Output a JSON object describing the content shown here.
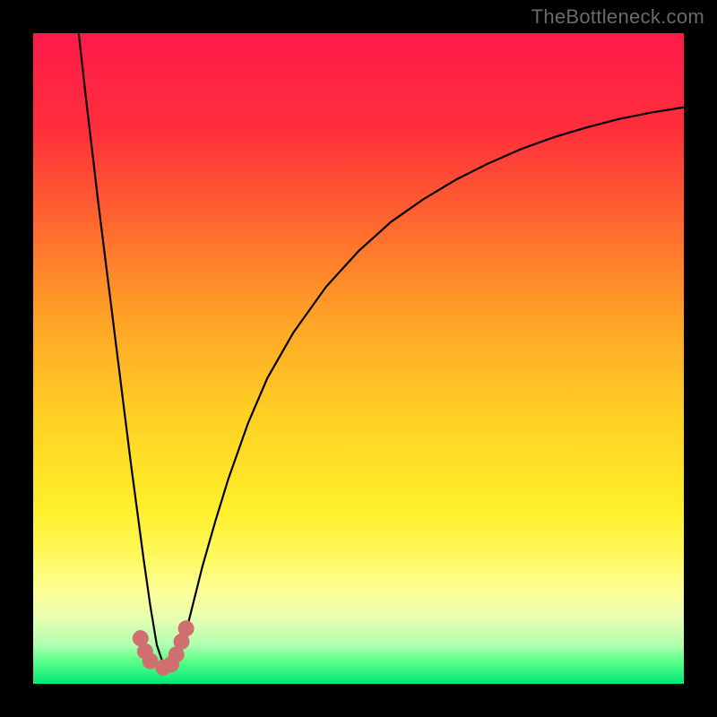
{
  "watermark": {
    "text": "TheBottleneck.com"
  },
  "chart_data": {
    "type": "line",
    "title": "",
    "xlabel": "",
    "ylabel": "",
    "xlim": [
      0,
      100
    ],
    "ylim": [
      0,
      100
    ],
    "gradient_stops": [
      {
        "offset": 0.0,
        "color": "#ff1a4b"
      },
      {
        "offset": 0.15,
        "color": "#ff2f3b"
      },
      {
        "offset": 0.3,
        "color": "#ff6b2e"
      },
      {
        "offset": 0.45,
        "color": "#ffa726"
      },
      {
        "offset": 0.6,
        "color": "#ffd324"
      },
      {
        "offset": 0.73,
        "color": "#ffef2a"
      },
      {
        "offset": 0.8,
        "color": "#fff85a"
      },
      {
        "offset": 0.86,
        "color": "#fdff9a"
      },
      {
        "offset": 0.9,
        "color": "#e6ffb0"
      },
      {
        "offset": 0.94,
        "color": "#b0ffb0"
      },
      {
        "offset": 0.965,
        "color": "#5bff8a"
      },
      {
        "offset": 1.0,
        "color": "#00e878"
      }
    ],
    "minimum_x": 19,
    "series": [
      {
        "name": "bottleneck-curve",
        "color": "#000000",
        "x": [
          7.0,
          8.0,
          9.0,
          10.0,
          11.0,
          12.0,
          13.0,
          14.0,
          15.0,
          16.0,
          17.0,
          18.0,
          19.0,
          20.0,
          21.0,
          22.0,
          23.0,
          24.0,
          25.0,
          26.0,
          28.0,
          30.0,
          33.0,
          36.0,
          40.0,
          45.0,
          50.0,
          55.0,
          60.0,
          65.0,
          70.0,
          75.0,
          80.0,
          85.0,
          90.0,
          95.0,
          100.0
        ],
        "y": [
          100.0,
          91.0,
          82.5,
          74.0,
          66.0,
          58.0,
          50.0,
          42.0,
          34.0,
          26.5,
          19.0,
          12.0,
          6.0,
          3.0,
          2.0,
          3.0,
          6.0,
          10.0,
          14.0,
          18.0,
          25.0,
          31.5,
          40.0,
          47.0,
          54.0,
          61.0,
          66.5,
          71.0,
          74.5,
          77.5,
          80.0,
          82.2,
          84.0,
          85.5,
          86.8,
          87.8,
          88.6
        ]
      }
    ],
    "markers": [
      {
        "x": 16.5,
        "y": 7.0,
        "color": "#cf6f6f"
      },
      {
        "x": 17.2,
        "y": 5.0,
        "color": "#cf6f6f"
      },
      {
        "x": 18.0,
        "y": 3.5,
        "color": "#cf6f6f"
      },
      {
        "x": 20.0,
        "y": 2.5,
        "color": "#cf6f6f"
      },
      {
        "x": 21.2,
        "y": 3.0,
        "color": "#cf6f6f"
      },
      {
        "x": 22.0,
        "y": 4.5,
        "color": "#cf6f6f"
      },
      {
        "x": 22.8,
        "y": 6.5,
        "color": "#cf6f6f"
      },
      {
        "x": 23.5,
        "y": 8.5,
        "color": "#cf6f6f"
      }
    ]
  }
}
